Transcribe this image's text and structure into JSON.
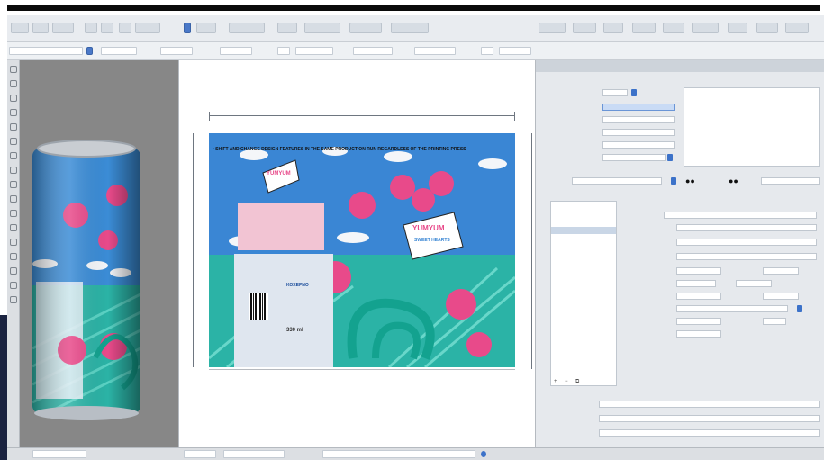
{
  "window": {
    "title": ""
  },
  "artwork": {
    "headline": "• SHIFT AND CHANGE DESIGN FEATURES IN THE SAME PRODUCTION RUN REGARDLESS OF THE PRINTING PRESS",
    "brand": "YUMYUM",
    "product": "SWEET HEARTS",
    "volume": "330 ml",
    "company": "ΚΟΧΕΡΝΟ",
    "colors": {
      "sky": "#3a86d4",
      "teal": "#2bb3a6",
      "pink": "#e84a8a",
      "cloud": "#f4f6f9"
    }
  },
  "canvas": {
    "dimension_top": "",
    "marks_top": [
      "",
      "",
      ""
    ]
  },
  "panel": {
    "section1": "",
    "section2": "",
    "section3": "",
    "section4": "",
    "list_items": [
      "",
      ""
    ],
    "fields": {
      "name": ""
    },
    "icons": [
      "eye-icon",
      "eye-icon",
      "target-icon",
      "target-icon"
    ]
  },
  "status": {
    "text": ""
  }
}
